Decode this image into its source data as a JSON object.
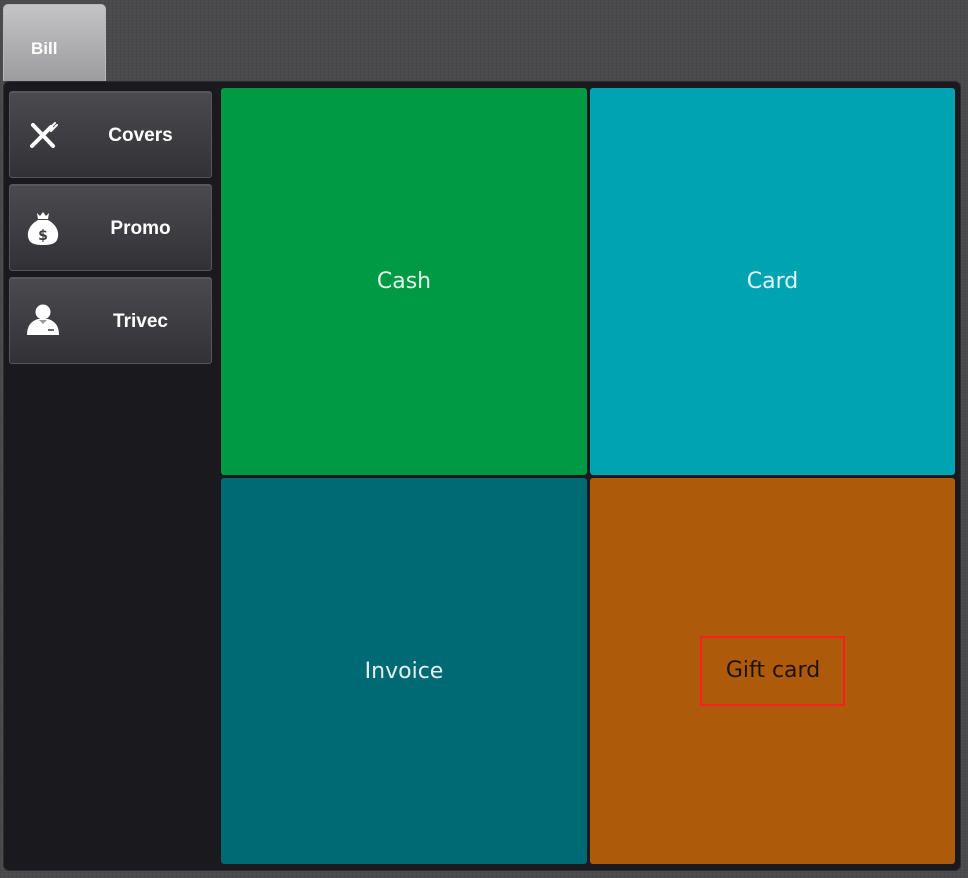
{
  "tabs": {
    "active_label": "Bill"
  },
  "sidebar": {
    "items": [
      {
        "label": "Covers",
        "icon": "cutlery-icon"
      },
      {
        "label": "Promo",
        "icon": "money-bag-icon"
      },
      {
        "label": "Trivec",
        "icon": "waiter-icon"
      }
    ]
  },
  "payment_methods": {
    "cash": {
      "label": "Cash",
      "color": "#009a44"
    },
    "card": {
      "label": "Card",
      "color": "#00a3b1"
    },
    "invoice": {
      "label": "Invoice",
      "color": "#006a74"
    },
    "gift_card": {
      "label": "Gift card",
      "color": "#ad5a0b"
    }
  }
}
